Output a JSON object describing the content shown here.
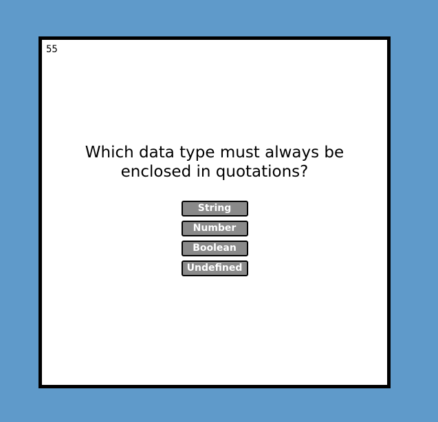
{
  "timer": {
    "value": "55"
  },
  "question": {
    "line1": "Which data type must always be",
    "line2": "enclosed in quotations?"
  },
  "answers": [
    {
      "label": "String"
    },
    {
      "label": "Number"
    },
    {
      "label": "Boolean"
    },
    {
      "label": "Undefined"
    }
  ],
  "colors": {
    "page_background": "#5f9aca",
    "card_background": "#ffffff",
    "card_border": "#000000",
    "button_background": "#8a8a8a",
    "button_text": "#ffffff"
  }
}
